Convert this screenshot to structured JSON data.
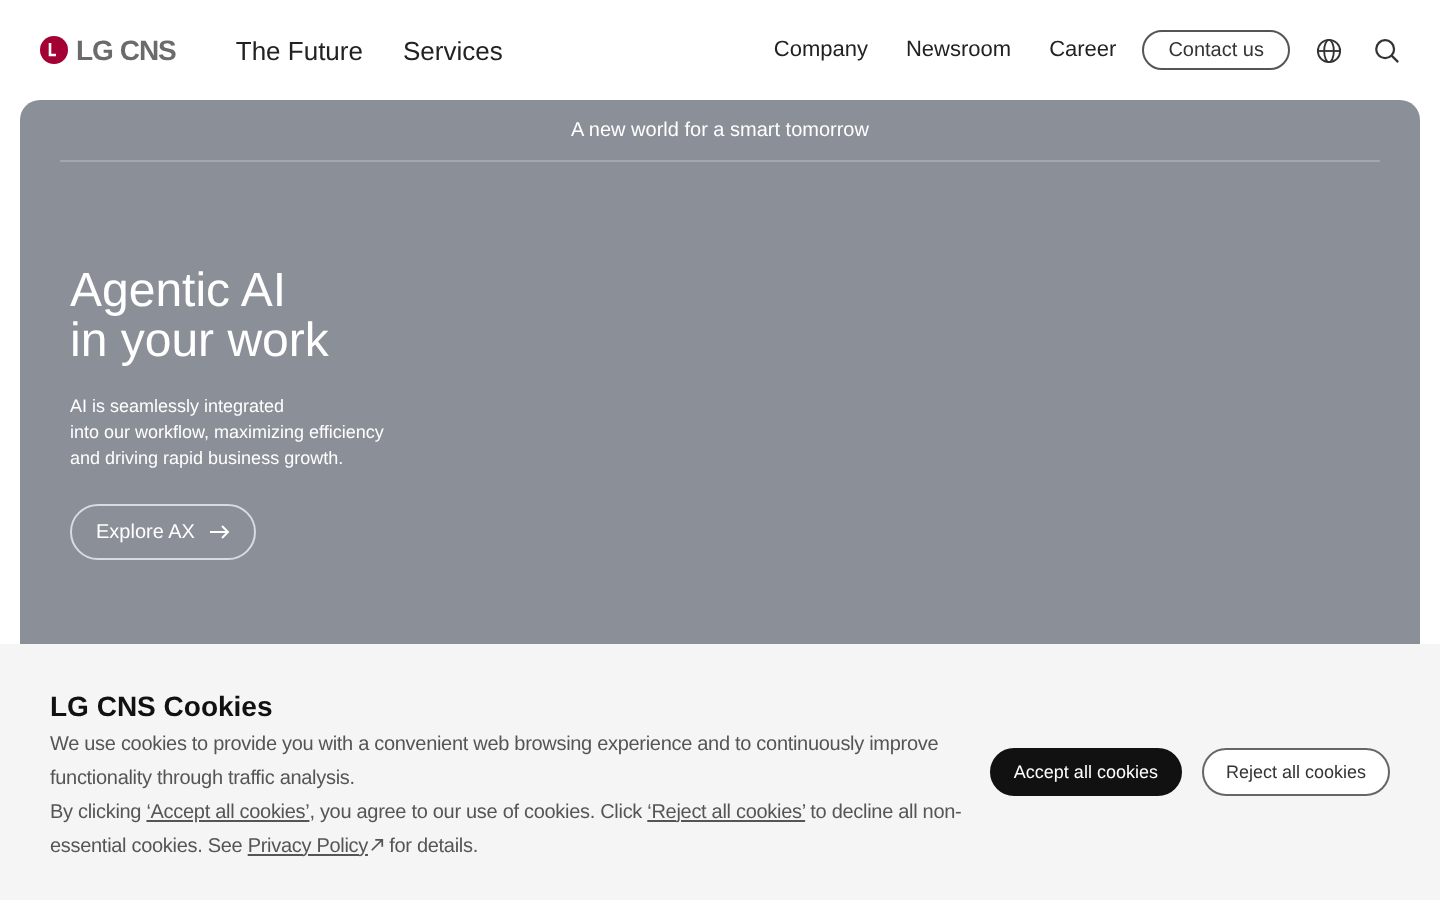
{
  "header": {
    "logo": "LG CNS",
    "primary_nav": [
      "The Future",
      "Services"
    ],
    "secondary_nav": [
      "Company",
      "Newsroom",
      "Career"
    ],
    "contact_button": "Contact us"
  },
  "hero": {
    "tagline": "A new world for a smart tomorrow",
    "heading": [
      "Agentic AI",
      "in your work"
    ],
    "description": [
      "AI is seamlessly integrated",
      "into our workflow, maximizing efficiency",
      "and driving rapid business growth."
    ],
    "button": "Explore AX"
  },
  "cookie_banner": {
    "title": "LG CNS Cookies",
    "paragraph_1": "We use cookies to provide you with a convenient web browsing experience and to continuously improve functionality through traffic analysis.",
    "paragraph_2": [
      {
        "kind": "text",
        "text": "By clicking "
      },
      {
        "kind": "link",
        "text": "‘Accept all cookies’"
      },
      {
        "kind": "text",
        "text": ", you agree to our use of cookies. Click "
      },
      {
        "kind": "link",
        "text": "‘Reject all cookies’"
      },
      {
        "kind": "text",
        "text": " to decline all non-essential cookies. See "
      },
      {
        "kind": "external_link",
        "text": "Privacy Policy"
      },
      {
        "kind": "text",
        "text": " for details."
      }
    ],
    "accept_button": "Accept all cookies",
    "reject_button": "Reject all cookies"
  }
}
